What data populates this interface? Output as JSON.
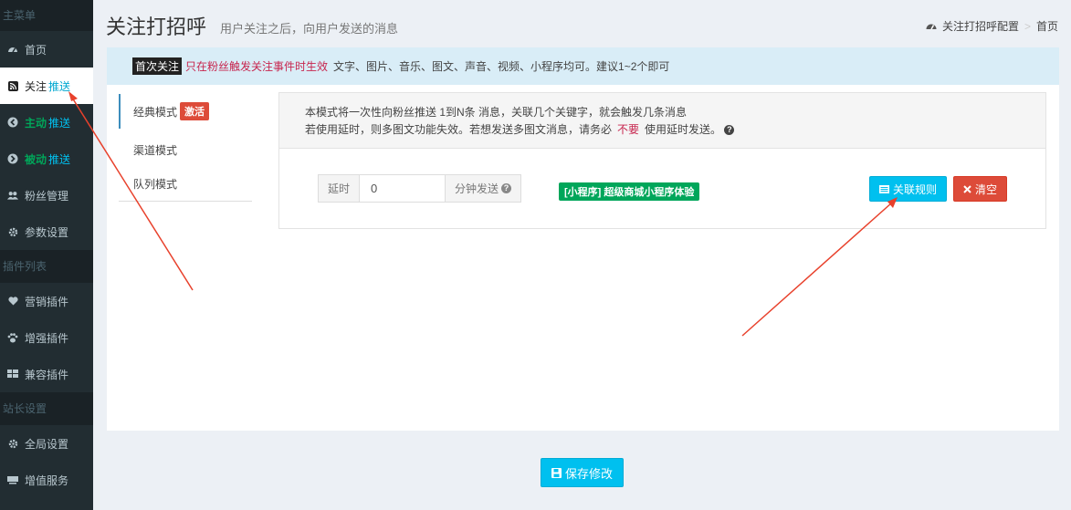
{
  "sidebar": {
    "header": "主菜单",
    "items": [
      {
        "icon": "dashboard-icon",
        "label": "首页",
        "suffix": ""
      },
      {
        "icon": "rss-icon",
        "label": "关注",
        "suffix": "推送"
      },
      {
        "icon": "arrow-circle-left-icon",
        "label": "主动",
        "suffix": "推送"
      },
      {
        "icon": "arrow-circle-right-icon",
        "label": "被动",
        "suffix": "推送"
      },
      {
        "icon": "users-icon",
        "label": "粉丝管理",
        "suffix": ""
      },
      {
        "icon": "gear-icon",
        "label": "参数设置",
        "suffix": ""
      }
    ],
    "plugins_header": "插件列表",
    "plugin_items": [
      {
        "icon": "heart-icon",
        "label": "营销插件"
      },
      {
        "icon": "paw-icon",
        "label": "增强插件"
      },
      {
        "icon": "grid-icon",
        "label": "兼容插件"
      }
    ],
    "admin_header": "站长设置",
    "admin_items": [
      {
        "icon": "gear-icon",
        "label": "全局设置"
      },
      {
        "icon": "keyboard-icon",
        "label": "增值服务"
      }
    ]
  },
  "header": {
    "title": "关注打招呼",
    "subtitle": "用户关注之后，向用户发送的消息",
    "breadcrumb_current": "关注打招呼配置",
    "breadcrumb_separator": ">",
    "breadcrumb_home": "首页"
  },
  "callout": {
    "tag": "首次关注",
    "highlight": "只在粉丝触发关注事件时生效",
    "text": "文字、图片、音乐、图文、声音、视频、小程序均可。建议1~2个即可"
  },
  "tabs": [
    {
      "label": "经典模式",
      "badge": "激活"
    },
    {
      "label": "渠道模式",
      "badge": ""
    },
    {
      "label": "队列模式",
      "badge": ""
    }
  ],
  "panel": {
    "line1": "本模式将一次性向粉丝推送 1到N条 消息，关联几个关键字，就会触发几条消息",
    "line2_a": "若使用延时，则多图文功能失效。若想发送多图文消息，请务必",
    "line2_warn": "不要",
    "line2_b": "使用延时发送。",
    "delay_label": "延时",
    "delay_value": "0",
    "delay_unit": "分钟发送",
    "miniprogram_label": "[小程序] 超级商城小程序体验",
    "rule_button": "关联规则",
    "clear_button": "清空"
  },
  "save_button": "保存修改",
  "colors": {
    "sidebar_bg": "#222d32",
    "accent_info": "#00c0ef",
    "accent_danger": "#dd4b39",
    "accent_success": "#00a65a",
    "callout_bg": "#d9edf7",
    "annotation_arrow": "#e8412c"
  }
}
